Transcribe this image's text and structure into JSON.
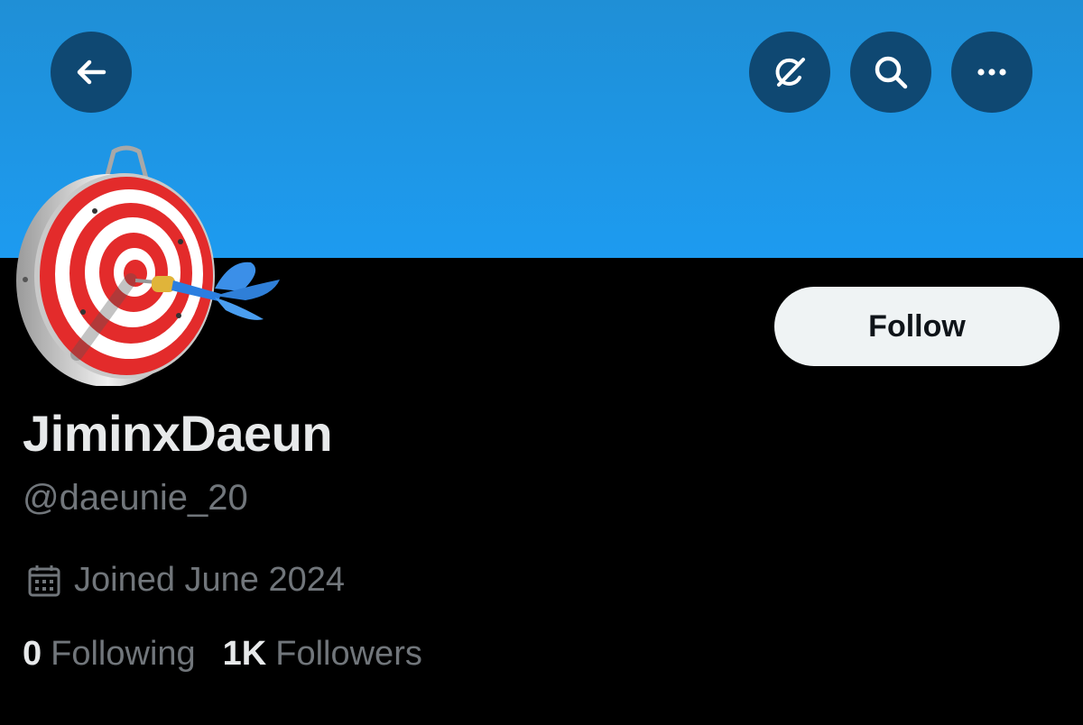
{
  "profile": {
    "display_name": "JiminxDaeun",
    "handle": "@daeunie_20",
    "joined": "Joined June 2024",
    "following_count": "0",
    "following_label": "Following",
    "followers_count": "1K",
    "followers_label": "Followers"
  },
  "actions": {
    "follow_label": "Follow"
  },
  "header": {
    "icons": [
      "arrow-left-icon",
      "grok-icon",
      "search-icon",
      "more-icon"
    ]
  },
  "colors": {
    "banner": "#1d9bf0",
    "header_button": "#0f4872",
    "follow_bg": "#eff3f4",
    "primary_text": "#e7e9ea",
    "secondary_text": "#71767b"
  }
}
